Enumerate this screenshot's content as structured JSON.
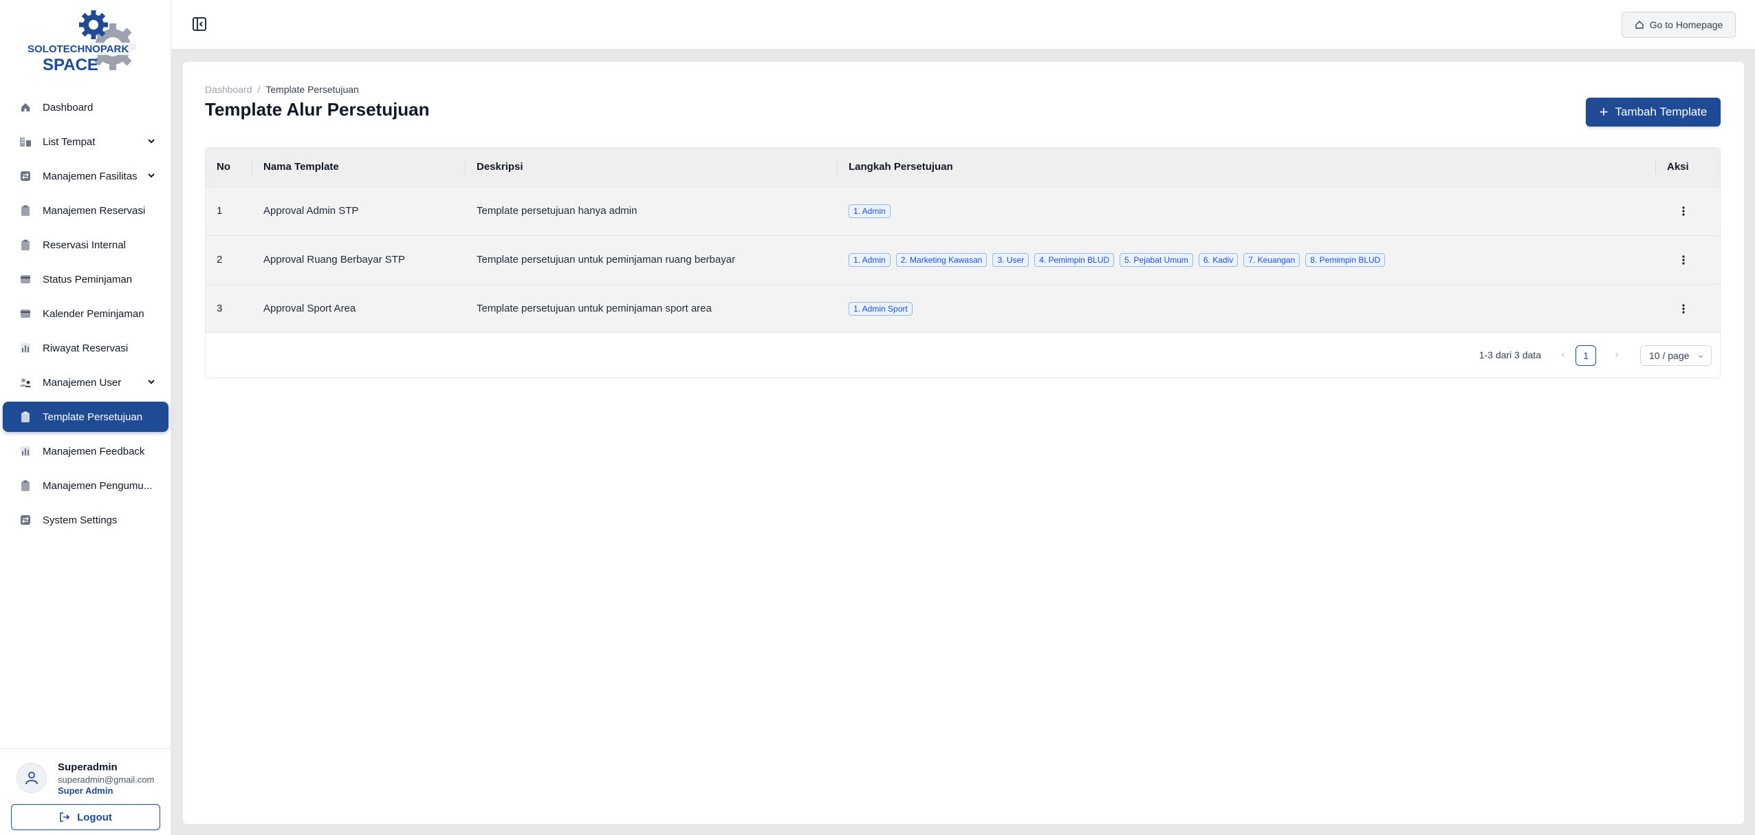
{
  "logo": {
    "text_top": "SOLOTECHNOPARK",
    "text_bottom": "SPACE"
  },
  "sidebar": {
    "items": [
      {
        "label": "Dashboard",
        "icon": "home-icon",
        "has_chevron": false,
        "active": false
      },
      {
        "label": "List Tempat",
        "icon": "building-icon",
        "has_chevron": true,
        "active": false
      },
      {
        "label": "Manajemen Fasilitas",
        "icon": "swap-icon",
        "has_chevron": true,
        "active": false
      },
      {
        "label": "Manajemen Reservasi",
        "icon": "clipboard-icon",
        "has_chevron": false,
        "active": false
      },
      {
        "label": "Reservasi Internal",
        "icon": "clipboard-icon",
        "has_chevron": false,
        "active": false
      },
      {
        "label": "Status Peminjaman",
        "icon": "card-icon",
        "has_chevron": false,
        "active": false
      },
      {
        "label": "Kalender Peminjaman",
        "icon": "card-icon",
        "has_chevron": false,
        "active": false
      },
      {
        "label": "Riwayat Reservasi",
        "icon": "bar-chart-icon",
        "has_chevron": false,
        "active": false
      },
      {
        "label": "Manajemen User",
        "icon": "users-icon",
        "has_chevron": true,
        "active": false
      },
      {
        "label": "Template Persetujuan",
        "icon": "clipboard-icon",
        "has_chevron": false,
        "active": true
      },
      {
        "label": "Manajemen Feedback",
        "icon": "bar-chart-icon",
        "has_chevron": false,
        "active": false
      },
      {
        "label": "Manajemen Pengumu...",
        "icon": "clipboard-icon",
        "has_chevron": false,
        "active": false
      },
      {
        "label": "System Settings",
        "icon": "swap-icon",
        "has_chevron": false,
        "active": false
      }
    ]
  },
  "user": {
    "name": "Superadmin",
    "email": "superadmin@gmail.com",
    "role": "Super Admin",
    "logout_label": "Logout"
  },
  "topbar": {
    "home_label": "Go to Homepage"
  },
  "breadcrumb": {
    "root": "Dashboard",
    "separator": "/",
    "current": "Template Persetujuan"
  },
  "page": {
    "title": "Template Alur Persetujuan",
    "add_label": "Tambah Template"
  },
  "table": {
    "headers": {
      "no": "No",
      "name": "Nama Template",
      "desc": "Deskripsi",
      "steps": "Langkah Persetujuan",
      "action": "Aksi"
    },
    "rows": [
      {
        "no": "1",
        "name": "Approval Admin STP",
        "desc": "Template persetujuan hanya admin",
        "steps": [
          "1. Admin"
        ]
      },
      {
        "no": "2",
        "name": "Approval Ruang Berbayar STP",
        "desc": "Template persetujuan untuk peminjaman ruang berbayar",
        "steps": [
          "1. Admin",
          "2. Marketing Kawasan",
          "3. User",
          "4. Pemimpin BLUD",
          "5. Pejabat Umum",
          "6. Kadiv",
          "7. Keuangan",
          "8. Pemimpin BLUD"
        ]
      },
      {
        "no": "3",
        "name": "Approval Sport Area",
        "desc": "Template persetujuan untuk peminjaman sport area",
        "steps": [
          "1. Admin Sport"
        ]
      }
    ]
  },
  "pagination": {
    "total_text": "1-3 dari 3 data",
    "current_page": "1",
    "page_size": "10 / page"
  },
  "colors": {
    "primary": "#1e4b93",
    "tag_text": "#1d4ed8",
    "tag_bg": "#eaf3ff"
  }
}
